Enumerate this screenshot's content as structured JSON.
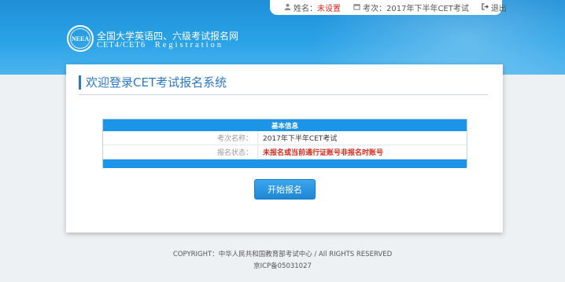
{
  "topbar": {
    "name_label": "姓名：",
    "name_value": "未设置",
    "exam_label": "考次：",
    "exam_value": "2017年下半年CET考试",
    "logout_label": "退出"
  },
  "header": {
    "logo_text": "NEEA",
    "title": "全国大学英语四、六级考试报名网",
    "subtitle": "CET4/CET6",
    "subtitle_en": "Registration"
  },
  "main": {
    "welcome": "欢迎登录CET考试报名系统",
    "info_table": {
      "heading": "基本信息",
      "rows": [
        {
          "label": "考次名称：",
          "value": "2017年下半年CET考试"
        },
        {
          "label": "报名状态：",
          "value": "未报名或当前通行证账号非报名时账号"
        }
      ]
    },
    "start_button": "开始报名"
  },
  "footer": {
    "copyright": "COPYRIGHT：中华人民共和国教育部考试中心 / All RIGHTS RESERVED",
    "icp": "京ICP备05031027"
  },
  "colors": {
    "header_blue": "#2aa2e6",
    "accent_blue": "#1c95e8",
    "title_blue": "#2b78c5",
    "alert_red": "#d52b1e"
  },
  "icons": [
    "user-icon",
    "calendar-icon",
    "logout-icon"
  ]
}
